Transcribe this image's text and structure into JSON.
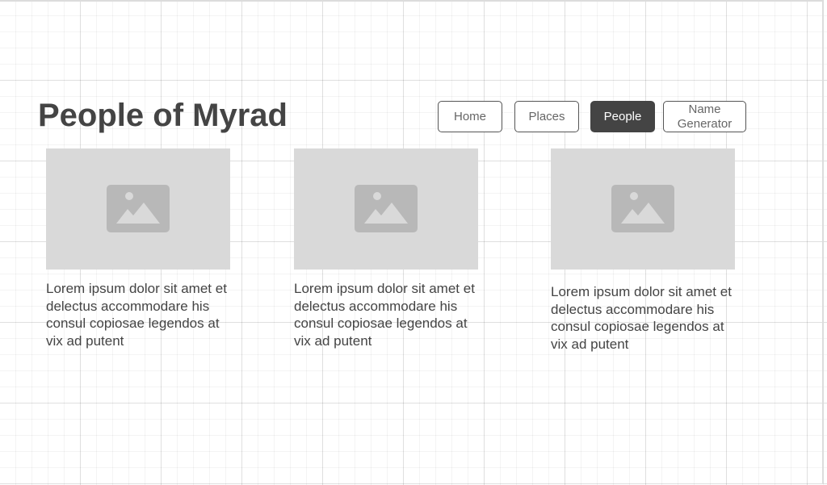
{
  "page": {
    "title": "People of Myrad"
  },
  "nav": {
    "items": [
      {
        "label": "Home",
        "active": false
      },
      {
        "label": "Places",
        "active": false
      },
      {
        "label": "People",
        "active": true
      },
      {
        "label": "Name\nGenerator",
        "line1": "Name",
        "line2": "Generator",
        "active": false
      }
    ]
  },
  "cards": [
    {
      "image": "image-placeholder-icon",
      "text": "Lorem ipsum dolor sit amet et delectus accommodare his consul copiosae legendos at vix ad putent"
    },
    {
      "image": "image-placeholder-icon",
      "text": "Lorem ipsum dolor sit amet et delectus accommodare his consul copiosae legendos at vix ad putent"
    },
    {
      "image": "image-placeholder-icon",
      "text": "Lorem ipsum dolor sit amet et delectus accommodare his consul copiosae legendos at vix ad putent"
    }
  ],
  "colors": {
    "text": "#444444",
    "active_button": "#444444",
    "placeholder_bg": "#d9d9d9",
    "placeholder_icon": "#b8b8b8"
  }
}
